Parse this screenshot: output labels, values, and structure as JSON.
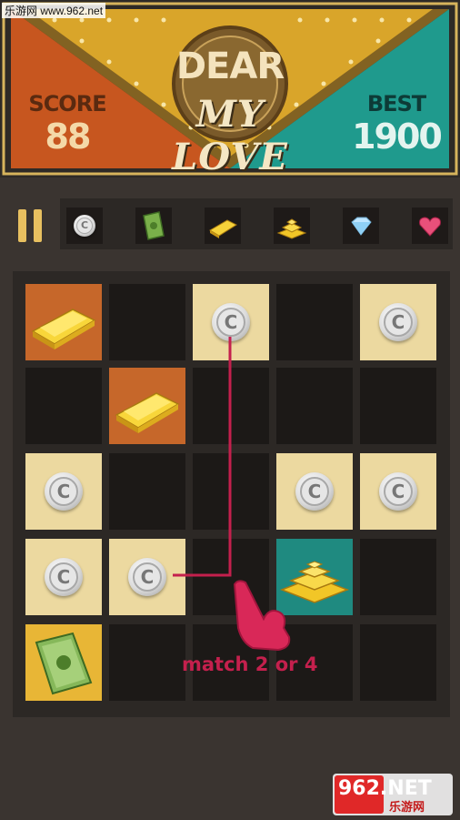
{
  "watermark": "乐游网 www.962.net",
  "header": {
    "title_line1": "DEAR",
    "title_line2": "MY LOVE",
    "score_label": "SCORE",
    "score_value": "88",
    "best_label": "BEST",
    "best_value": "1900"
  },
  "colors": {
    "orange_panel": "#c7561f",
    "gold_panel": "#d9a52a",
    "teal_panel": "#1f9a8d",
    "coin_tile": "#ecd9a0",
    "hint_red": "#c4204d"
  },
  "toolbar": {
    "pause_icon": "pause-icon",
    "items": [
      "coin",
      "cash",
      "gold-bar",
      "gold-stack",
      "diamond",
      "heart-gem"
    ]
  },
  "board": {
    "rows": [
      [
        "gold-bar",
        "",
        "coin",
        "",
        "coin"
      ],
      [
        "",
        "gold-bar",
        "",
        "",
        ""
      ],
      [
        "coin",
        "",
        "",
        "coin",
        "coin"
      ],
      [
        "coin",
        "coin",
        "",
        "gold-stack",
        ""
      ],
      [
        "cash",
        "",
        "",
        "",
        ""
      ]
    ],
    "coin_letter": "C"
  },
  "hint": {
    "text": "match 2 or 4"
  },
  "logo": {
    "text_top": "962.NET",
    "text_bottom": "乐游网"
  }
}
